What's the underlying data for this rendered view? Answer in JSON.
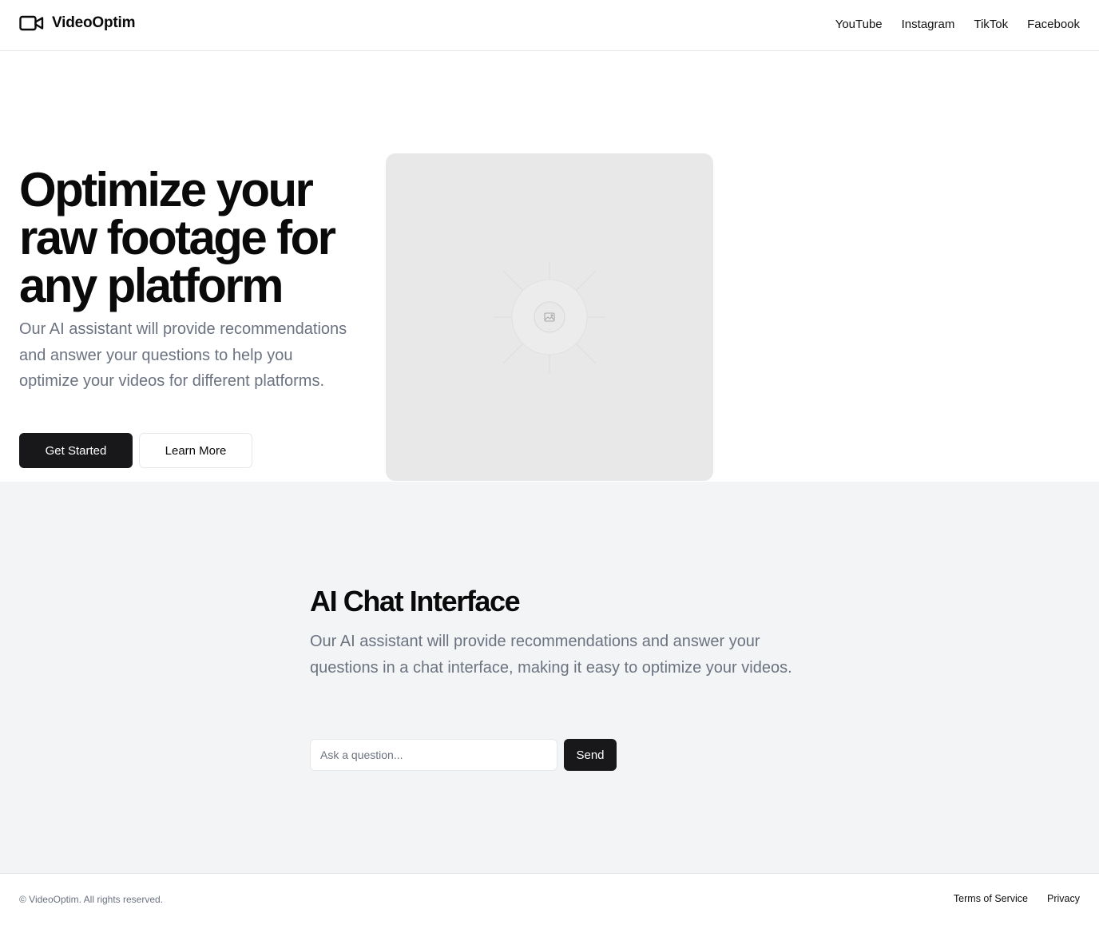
{
  "header": {
    "brand_name": "VideoOptim",
    "brand_icon": "video-camera-icon",
    "nav": {
      "youtube": "YouTube",
      "instagram": "Instagram",
      "tiktok": "TikTok",
      "facebook": "Facebook"
    }
  },
  "hero": {
    "title": "Optimize your raw footage for any platform",
    "description": "Our AI assistant will provide recommendations and answer your questions to help you optimize your videos for different platforms.",
    "primary_button": "Get Started",
    "secondary_button": "Learn More",
    "image_icon": "image-placeholder-icon"
  },
  "chat": {
    "title": "AI Chat Interface",
    "description": "Our AI assistant will provide recommendations and answer your questions in a chat interface, making it easy to optimize your videos.",
    "input_placeholder": "Ask a question...",
    "send_button": "Send"
  },
  "footer": {
    "copyright": "© VideoOptim. All rights reserved.",
    "terms": "Terms of Service",
    "privacy": "Privacy"
  },
  "colors": {
    "primary": "#18181b",
    "muted_text": "#6b7280",
    "section_bg": "#f3f4f6",
    "placeholder_bg": "#e8e8e8",
    "border": "#e5e7eb"
  }
}
